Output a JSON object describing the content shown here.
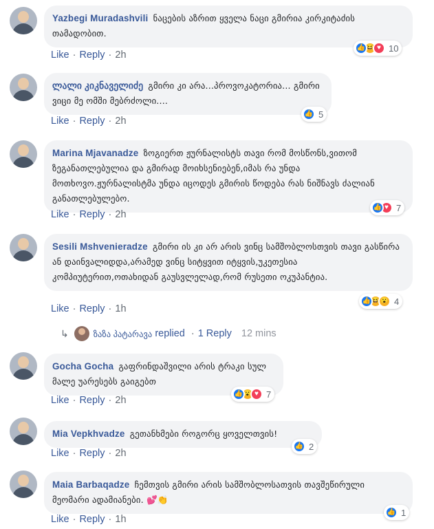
{
  "action_labels": {
    "like": "Like",
    "reply": "Reply",
    "dot": "·"
  },
  "colors": {
    "author_link": "#385898",
    "bubble_bg": "#f2f3f5",
    "meta_text": "#606770",
    "like_blue": "#1877f2",
    "love_red": "#f33e58",
    "emoji_yellow": "#f7b125"
  },
  "comments": [
    {
      "author": "Yazbegi Muradashvili",
      "text": "ნაცების აზრით ყველა ნაცი გმირია კირკიტაძის თამადობით.",
      "time": "2h",
      "reactions": [
        "like-icon",
        "haha-icon",
        "love-icon"
      ],
      "reaction_count": "10"
    },
    {
      "author": "ლალი კიკნაველიძე",
      "text": "გმირი კი არა...პროვოკატორია... გმირი ვიცი მე ომში მებრძოლი....",
      "time": "2h",
      "reactions": [
        "like-icon"
      ],
      "reaction_count": "5"
    },
    {
      "author": "Marina Mjavanadze",
      "text": "ზოგიერთ ჟურნალისტს თავი რომ მოსწონს,ვითომ ზეგანათლებულია და გმირად მოიხსენიებენ,იმას რა უნდა მოთხოვო.ჟურნალისტმა უნდა იცოდეს გმირის წოდება რას ნიშნავს ძალიან განათლებულებო.",
      "time": "2h",
      "reactions": [
        "like-icon",
        "love-icon"
      ],
      "reaction_count": "7"
    },
    {
      "author": "Sesili Mshvenieradze",
      "text": "გმირი ის კი არ არის ვინც სამშობლოსთვის თავი გასწირა ან დაინვალიდდა,არამედ ვინც სიტყვით იტყვის,უკეთესია კომპიუტერით,ოთახიდან გაუსვლელად,რომ რუსეთი ოკუპანტია.",
      "time": "1h",
      "reactions": [
        "like-icon",
        "haha-icon",
        "wow-icon"
      ],
      "reaction_count": "4"
    },
    {
      "author": "Gocha Gocha",
      "text": "გაფრინდაშვილი არის ტრაკი სულ მალე უარესებს გაიგებთ",
      "time": "2h",
      "reactions": [
        "like-icon",
        "wow-icon",
        "love-icon"
      ],
      "reaction_count": "7"
    },
    {
      "author": "Mia Vepkhvadze",
      "text": "გეთანხმები როგორც ყოველთვის!",
      "time": "2h",
      "reactions": [
        "like-icon"
      ],
      "reaction_count": "2"
    },
    {
      "author": "Maia Barbaqadze",
      "text": "ჩემთვის გმირი არის სამშობლოსათვის თავშეწირული მეომარი ადამიანები.",
      "emoji": "💕👏",
      "time": "1h",
      "reactions": [
        "like-icon"
      ],
      "reaction_count": "1"
    }
  ],
  "reply_summary": {
    "arrow": "↳",
    "name": "ზაზა პატარავა",
    "verb": "replied",
    "dot": "·",
    "count": "1 Reply",
    "time": "12 mins"
  }
}
